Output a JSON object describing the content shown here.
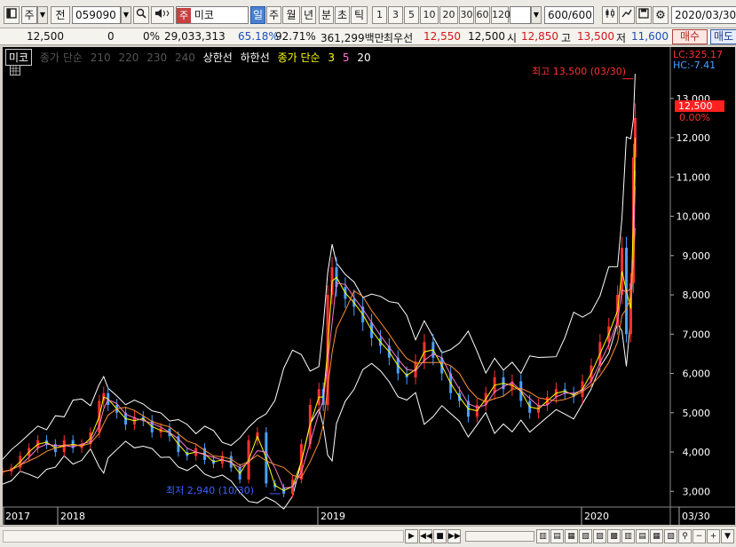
{
  "toolbar": {
    "period_type": "주",
    "stock_code": "059090",
    "stock_name": "미코",
    "stock_prefix": "주",
    "prev_label": "전",
    "intervals": [
      "일",
      "주",
      "월",
      "년",
      "분",
      "초",
      "틱"
    ],
    "selected_interval": "일",
    "minutes": [
      "1",
      "3",
      "5",
      "10",
      "20",
      "30",
      "60",
      "120"
    ],
    "count_value": "600",
    "count_total": "/600",
    "date": "2020/03/30"
  },
  "quote": {
    "price": "12,500",
    "change": "0",
    "change_pct": "0%",
    "volume": "29,033,313",
    "ratio1": "65.18%",
    "ratio2": "92.71%",
    "amount": "361,299백만",
    "best_label": "최우선",
    "best_ask": "12,550",
    "best_bid": "12,500",
    "open_label": "시",
    "open": "12,850",
    "high_label": "고",
    "high": "13,500",
    "low_label": "저",
    "low": "11,600",
    "buy_label": "매수",
    "sell_label": "매도"
  },
  "legend": {
    "tag": "미코",
    "ma_label": "종가 단순",
    "ma_long": [
      "210",
      "220",
      "230",
      "240"
    ],
    "band_upper": "상한선",
    "band_lower": "하한선",
    "ma_short_label": "종가 단순",
    "ma_short": [
      "3",
      "5",
      "20"
    ]
  },
  "axis": {
    "lc": "LC:325.17",
    "hc": "HC:-7.41",
    "current_price": "12,500",
    "current_pct": "0.00%",
    "high_note": "최고 13,500 (03/30)",
    "low_note": "최저 2,940 (10/30)"
  },
  "colors": {
    "up": "#ff3030",
    "down": "#4aa0ff",
    "ma3": "#ffff00",
    "ma5": "#ff7ad0",
    "ma20": "#ff9030",
    "band": "#ffffff"
  },
  "chart_data": {
    "type": "line",
    "title": "",
    "x_labels": [
      "2017",
      "2018",
      "2019",
      "2020",
      "03/30"
    ],
    "y_ticks": [
      3000,
      4000,
      5000,
      6000,
      7000,
      8000,
      9000,
      10000,
      11000,
      12000,
      13000
    ],
    "ylim": [
      2600,
      13900
    ],
    "series": [
      {
        "name": "종가",
        "points": [
          [
            0,
            3500
          ],
          [
            10,
            3600
          ],
          [
            20,
            3900
          ],
          [
            30,
            4100
          ],
          [
            40,
            4300
          ],
          [
            50,
            4200
          ],
          [
            60,
            4000
          ],
          [
            70,
            4300
          ],
          [
            80,
            4100
          ],
          [
            90,
            4200
          ],
          [
            100,
            4500
          ],
          [
            110,
            5300
          ],
          [
            115,
            5500
          ],
          [
            120,
            5200
          ],
          [
            130,
            5000
          ],
          [
            140,
            4700
          ],
          [
            150,
            4900
          ],
          [
            160,
            4800
          ],
          [
            170,
            4500
          ],
          [
            180,
            4600
          ],
          [
            190,
            4400
          ],
          [
            200,
            4000
          ],
          [
            210,
            3900
          ],
          [
            220,
            4100
          ],
          [
            230,
            3800
          ],
          [
            240,
            3700
          ],
          [
            250,
            3900
          ],
          [
            260,
            3600
          ],
          [
            270,
            3300
          ],
          [
            280,
            4300
          ],
          [
            290,
            4500
          ],
          [
            300,
            3200
          ],
          [
            310,
            3100
          ],
          [
            320,
            2940
          ],
          [
            330,
            3300
          ],
          [
            340,
            4200
          ],
          [
            350,
            5200
          ],
          [
            360,
            5600
          ],
          [
            365,
            5200
          ],
          [
            370,
            8000
          ],
          [
            375,
            8700
          ],
          [
            380,
            8200
          ],
          [
            390,
            7900
          ],
          [
            400,
            7700
          ],
          [
            410,
            7300
          ],
          [
            420,
            6900
          ],
          [
            430,
            6700
          ],
          [
            440,
            6400
          ],
          [
            450,
            6000
          ],
          [
            460,
            5900
          ],
          [
            470,
            6300
          ],
          [
            480,
            6800
          ],
          [
            490,
            6400
          ],
          [
            500,
            6000
          ],
          [
            510,
            5500
          ],
          [
            520,
            5300
          ],
          [
            530,
            4900
          ],
          [
            540,
            5200
          ],
          [
            550,
            5500
          ],
          [
            560,
            5900
          ],
          [
            570,
            5600
          ],
          [
            580,
            5800
          ],
          [
            590,
            5300
          ],
          [
            600,
            5000
          ],
          [
            610,
            5200
          ],
          [
            620,
            5400
          ],
          [
            630,
            5600
          ],
          [
            640,
            5500
          ],
          [
            650,
            5400
          ],
          [
            660,
            5800
          ],
          [
            670,
            6200
          ],
          [
            680,
            6800
          ],
          [
            690,
            7200
          ],
          [
            700,
            8000
          ],
          [
            705,
            9200
          ],
          [
            710,
            7000
          ],
          [
            715,
            8300
          ],
          [
            718,
            11500
          ],
          [
            720,
            12500
          ]
        ]
      }
    ]
  }
}
